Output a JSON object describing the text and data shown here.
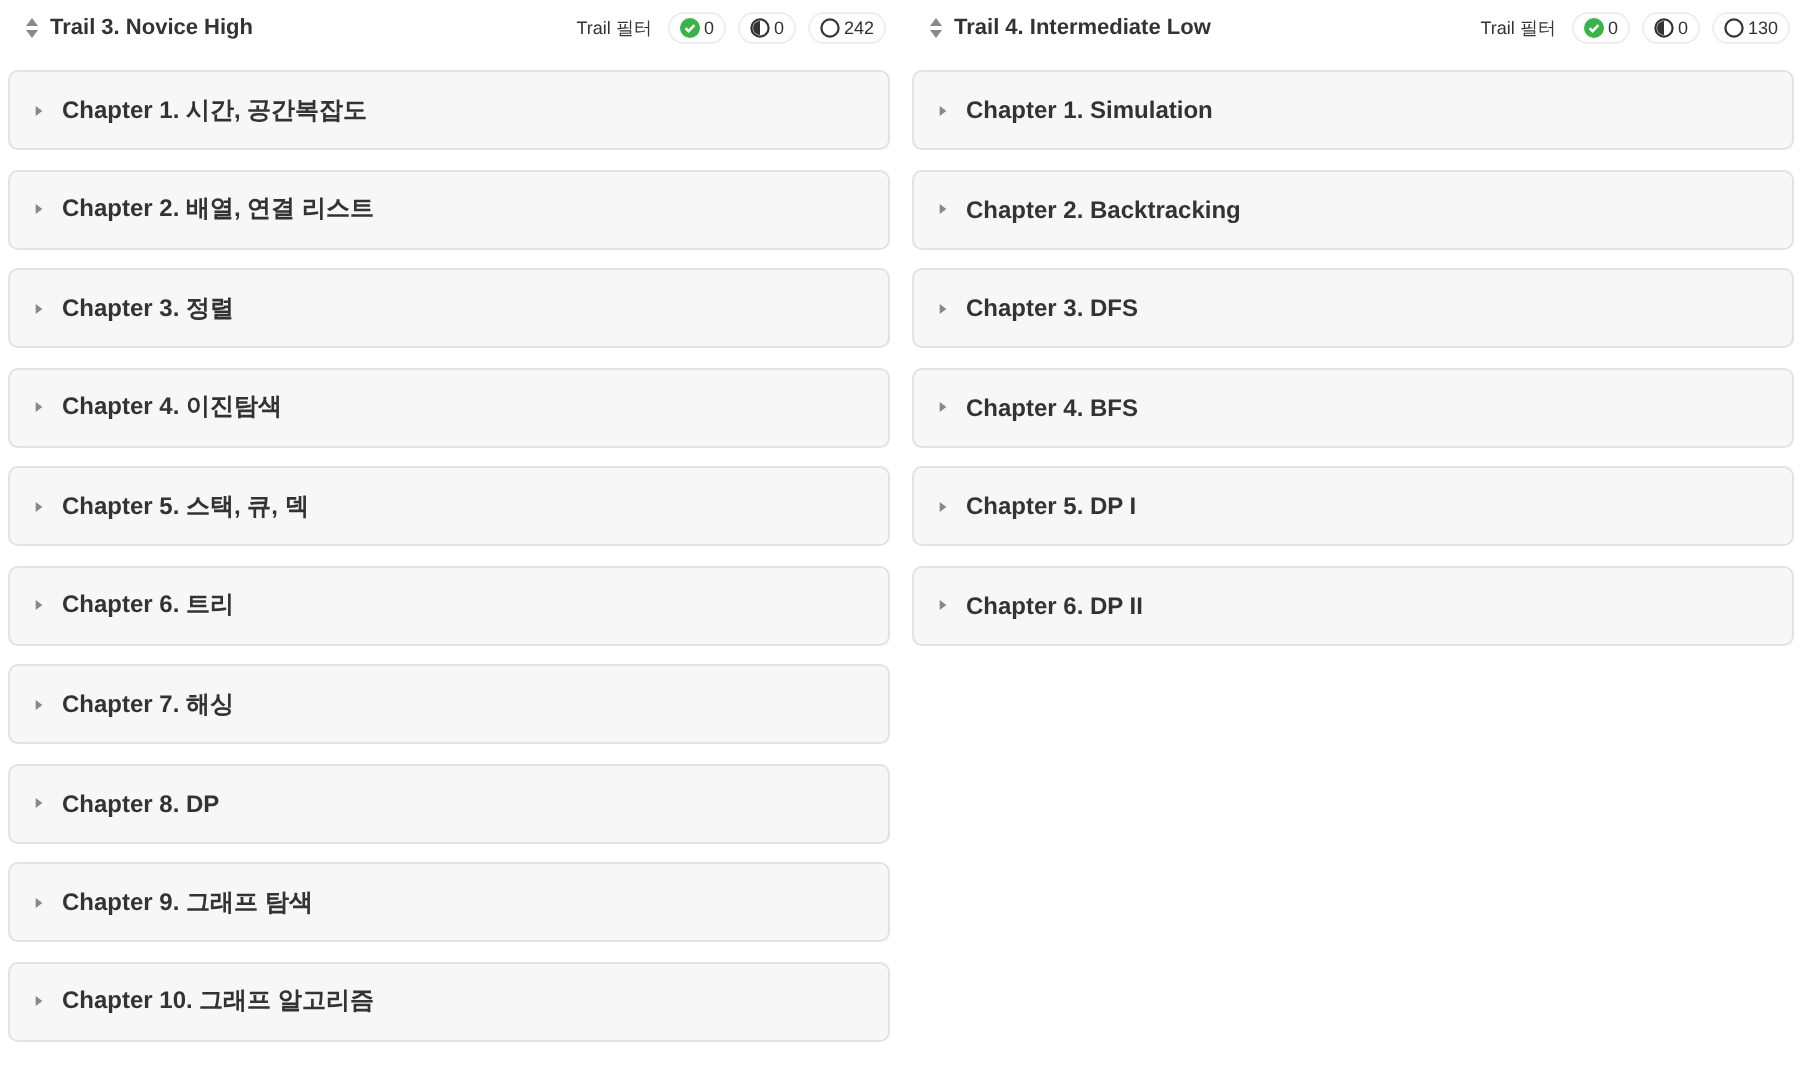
{
  "trails": [
    {
      "title": "Trail 3. Novice High",
      "filter_label": "Trail 필터",
      "filters": [
        {
          "kind": "solved",
          "count": "0"
        },
        {
          "kind": "partial",
          "count": "0"
        },
        {
          "kind": "unsolved",
          "count": "242"
        }
      ],
      "chapters": [
        {
          "title": "Chapter 1. 시간, 공간복잡도",
          "expanded": false
        },
        {
          "title": "Chapter 2. 배열, 연결 리스트",
          "expanded": false
        },
        {
          "title": "Chapter 3. 정렬",
          "expanded": false
        },
        {
          "title": "Chapter 4. 이진탐색",
          "expanded": false
        },
        {
          "title": "Chapter 5. 스택, 큐, 덱",
          "expanded": false
        },
        {
          "title": "Chapter 6. 트리",
          "expanded": false
        },
        {
          "title": "Chapter 7. 해싱",
          "expanded": false
        },
        {
          "title": "Chapter 8. DP",
          "expanded": false
        },
        {
          "title": "Chapter 9. 그래프 탐색",
          "expanded": false
        },
        {
          "title": "Chapter 10. 그래프 알고리즘",
          "expanded": false
        }
      ]
    },
    {
      "title": "Trail 4. Intermediate Low",
      "filter_label": "Trail 필터",
      "filters": [
        {
          "kind": "solved",
          "count": "0"
        },
        {
          "kind": "partial",
          "count": "0"
        },
        {
          "kind": "unsolved",
          "count": "130"
        }
      ],
      "chapters": [
        {
          "title": "Chapter 1. Simulation",
          "expanded": false
        },
        {
          "title": "Chapter 2. Backtracking",
          "expanded": false
        },
        {
          "title": "Chapter 3. DFS",
          "expanded": false
        },
        {
          "title": "Chapter 4. BFS",
          "expanded": false
        },
        {
          "title": "Chapter 5. DP I",
          "expanded": false
        },
        {
          "title": "Chapter 6. DP II",
          "expanded": false
        }
      ]
    }
  ]
}
